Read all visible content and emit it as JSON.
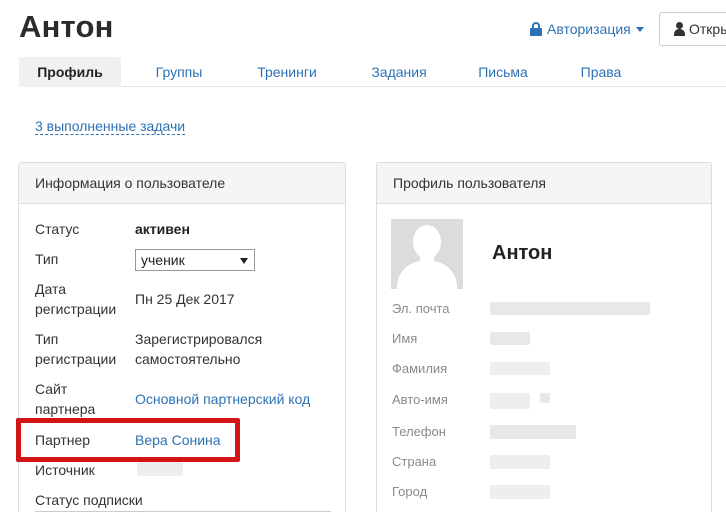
{
  "header": {
    "title": "Антон",
    "auth_label": "Авторизация",
    "open_label": "Откры"
  },
  "tabs": [
    {
      "label": "Профиль",
      "active": true
    },
    {
      "label": "Группы",
      "active": false
    },
    {
      "label": "Тренинги",
      "active": false
    },
    {
      "label": "Задания",
      "active": false
    },
    {
      "label": "Письма",
      "active": false
    },
    {
      "label": "Права",
      "active": false
    }
  ],
  "tasks_link": "3 выполненные задачи",
  "user_info": {
    "heading": "Информация о пользователе",
    "status_label": "Статус",
    "status_value": "активен",
    "type_label": "Тип",
    "type_value": "ученик",
    "reg_date_label_1": "Дата",
    "reg_date_label_2": "регистрации",
    "reg_date_value": "Пн 25 Дек 2017",
    "reg_type_label_1": "Тип",
    "reg_type_label_2": "регистрации",
    "reg_type_value_1": "Зарегистрировался",
    "reg_type_value_2": "самостоятельно",
    "partner_site_label_1": "Сайт",
    "partner_site_label_2": "партнера",
    "partner_site_value": "Основной партнерский код",
    "partner_label": "Партнер",
    "partner_value": "Вера Сонина",
    "source_label": "Источник",
    "subscription_label": "Статус подписки"
  },
  "profile": {
    "heading": "Профиль пользователя",
    "name": "Антон",
    "email_label": "Эл. почта",
    "first_name_label": "Имя",
    "last_name_label": "Фамилия",
    "auto_name_label": "Авто-имя",
    "phone_label": "Телефон",
    "country_label": "Страна",
    "city_label": "Город"
  },
  "colors": {
    "link": "#2d72b5",
    "highlight": "#d21414",
    "panel_header_bg": "#f5f5f5"
  }
}
